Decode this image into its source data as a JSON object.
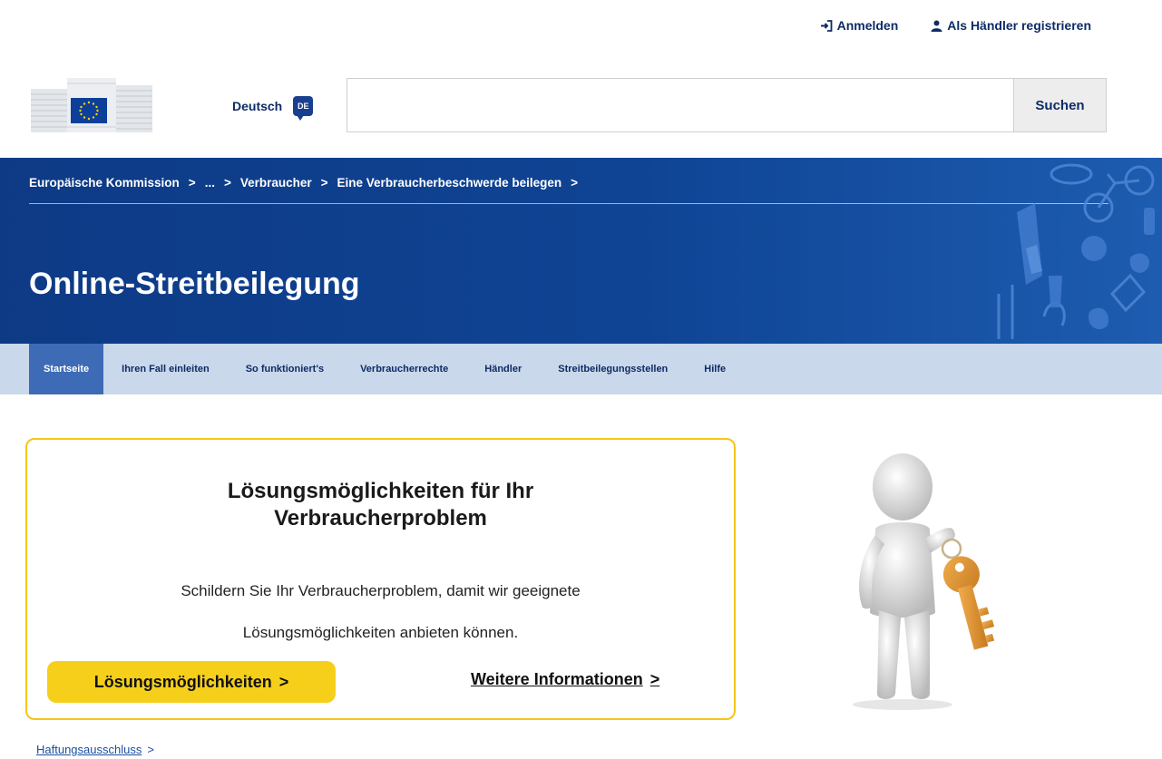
{
  "top_links": {
    "login": "Anmelden",
    "register": "Als Händler registrieren"
  },
  "header": {
    "language": "Deutsch",
    "language_code": "DE",
    "search_placeholder": "",
    "search_button": "Suchen"
  },
  "breadcrumb": {
    "items": [
      "Europäische Kommission",
      "...",
      "Verbraucher",
      "Eine Verbraucherbeschwerde beilegen"
    ],
    "separator": ">"
  },
  "page_title": "Online-Streitbeilegung",
  "nav": {
    "items": [
      {
        "label": "Startseite"
      },
      {
        "label": "Ihren Fall einleiten"
      },
      {
        "label": "So funktioniert's"
      },
      {
        "label": "Verbraucherrechte"
      },
      {
        "label": "Händler"
      },
      {
        "label": "Streitbeilegungsstellen"
      },
      {
        "label": "Hilfe"
      }
    ]
  },
  "card": {
    "title": "Lösungsmöglichkeiten für Ihr Verbraucherproblem",
    "text": "Schildern Sie Ihr Verbraucherproblem, damit wir geeignete Lösungsmöglichkeiten anbieten können.",
    "primary_button": "Lösungsmöglichkeiten",
    "more_link": "Weitere Informationen",
    "chevron": ">"
  },
  "footer": {
    "disclaimer": "Haftungsausschluss"
  },
  "colors": {
    "banner": "#0f4494",
    "nav_bg": "#c9d8ea",
    "nav_active": "#3e6bb5",
    "accent_yellow": "#f6cf1a",
    "link_blue": "#0e2b66"
  }
}
